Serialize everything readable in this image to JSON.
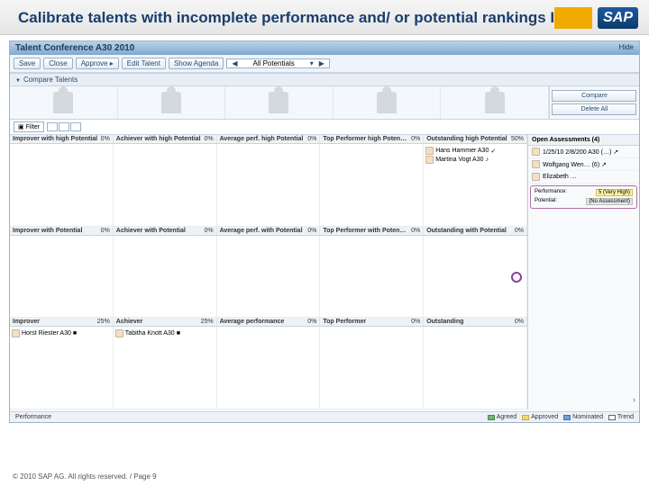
{
  "slide": {
    "title": "Calibrate talents with incomplete performance and/ or potential rankings IV",
    "footer": "© 2010 SAP AG. All rights reserved. / Page 9",
    "logo": "SAP"
  },
  "app": {
    "title": "Talent Conference A30 2010",
    "hide": "Hide"
  },
  "toolbar": {
    "save": "Save",
    "close": "Close",
    "approve": "Approve ▸",
    "edit_talent": "Edit Talent",
    "show_agenda": "Show Agenda",
    "nav_label": "All Potentials"
  },
  "section": {
    "compare": "Compare Talents"
  },
  "side_buttons": {
    "compare": "Compare",
    "delete_all": "Delete All"
  },
  "filter": "Filter",
  "grid": {
    "headers_row1": [
      {
        "label": "Improver with high Potential",
        "pct": "0%"
      },
      {
        "label": "Achiever with high Potential",
        "pct": "0%"
      },
      {
        "label": "Average perf. high Potential",
        "pct": "0%"
      },
      {
        "label": "Top Performer high Poten…",
        "pct": "0%"
      },
      {
        "label": "Outstanding high Potential",
        "pct": "50%"
      }
    ],
    "headers_row2": [
      {
        "label": "Improver with Potential",
        "pct": "0%"
      },
      {
        "label": "Achiever with Potential",
        "pct": "0%"
      },
      {
        "label": "Average perf. with Potential",
        "pct": "0%"
      },
      {
        "label": "Top Performer with Poten…",
        "pct": "0%"
      },
      {
        "label": "Outstanding with Potential",
        "pct": "0%"
      }
    ],
    "headers_row3": [
      {
        "label": "Improver",
        "pct": "25%"
      },
      {
        "label": "Achiever",
        "pct": "25%"
      },
      {
        "label": "Average performance",
        "pct": "0%"
      },
      {
        "label": "Top Performer",
        "pct": "0%"
      },
      {
        "label": "Outstanding",
        "pct": "0%"
      }
    ],
    "row1_col5": [
      {
        "name": "Hans Hammer A30",
        "suffix": "✓"
      },
      {
        "name": "Martina Vogt A30",
        "suffix": "♪"
      }
    ],
    "row3_col1": [
      {
        "name": "Horst Riester A30",
        "suffix": "■"
      }
    ],
    "row3_col2": [
      {
        "name": "Tabitha Knott A30",
        "suffix": "■"
      }
    ]
  },
  "assessments": {
    "header": "Open Assessments (4)",
    "items": [
      "1/25/10 2/8/200 A30 (…) ↗",
      "Wolfgang Wen… (6) ↗",
      "Elizabeth …"
    ],
    "box": {
      "perf_label": "Performance:",
      "perf_val": "5 (Very High)",
      "pot_label": "Potential:",
      "pot_val": "(No Assessment)"
    }
  },
  "footer": {
    "perf": "Performance",
    "legend": {
      "agreed": "Agreed",
      "approved": "Approved",
      "nominated": "Nominated",
      "trend": "Trend"
    }
  }
}
